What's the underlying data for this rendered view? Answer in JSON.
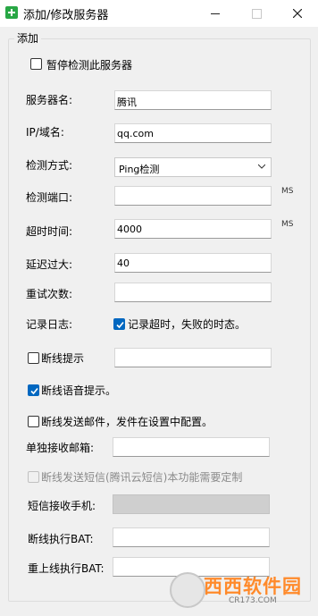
{
  "window": {
    "title": "添加/修改服务器"
  },
  "group": {
    "title": "添加"
  },
  "pause_check": {
    "label": "暂停检测此服务器",
    "checked": false
  },
  "fields": {
    "server_name": {
      "label": "服务器名:",
      "value": "腾讯"
    },
    "ip_domain": {
      "label": "IP/域名:",
      "value": "qq.com"
    },
    "check_method": {
      "label": "检测方式:",
      "value": "Ping检测"
    },
    "check_port": {
      "label": "检测端口:",
      "value": "",
      "unit": "MS"
    },
    "timeout": {
      "label": "超时时间:",
      "value": "4000",
      "unit": "MS"
    },
    "latency": {
      "label": "延迟过大:",
      "value": "40"
    },
    "retries": {
      "label": "重试次数:",
      "value": ""
    }
  },
  "log": {
    "label": "记录日志:",
    "option_label": "记录超时，失败的时态。",
    "checked": true
  },
  "disconnect_prompt": {
    "label": "断线提示",
    "checked": false,
    "value": ""
  },
  "voice_prompt": {
    "label": "断线语音提示。",
    "checked": true
  },
  "email_alert": {
    "label": "断线发送邮件，发件在设置中配置。",
    "checked": false
  },
  "separate_email": {
    "label": "单独接收邮箱:",
    "value": ""
  },
  "sms_alert": {
    "label": "断线发送短信(腾讯云短信)本功能需要定制",
    "checked": false,
    "disabled": true
  },
  "sms_phone": {
    "label": "短信接收手机:",
    "value": ""
  },
  "disconnect_bat": {
    "label": "断线执行BAT:",
    "value": ""
  },
  "reconnect_bat": {
    "label": "重上线执行BAT:",
    "value": ""
  },
  "watermark": {
    "logo_text": "西西软件园",
    "url": "CR173.COM"
  }
}
